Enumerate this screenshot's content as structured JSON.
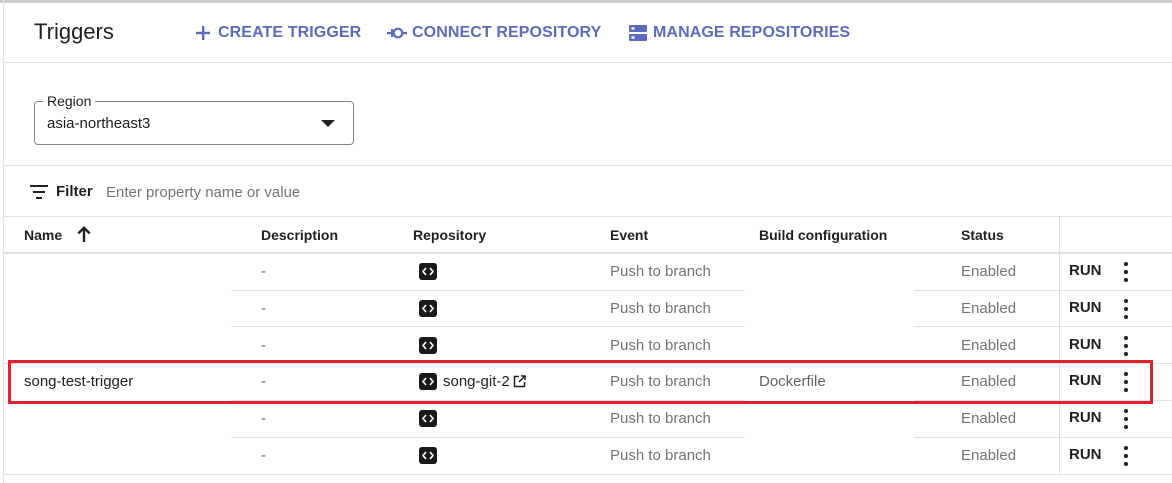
{
  "header": {
    "title": "Triggers",
    "create_trigger": "CREATE TRIGGER",
    "connect_repository": "CONNECT REPOSITORY",
    "manage_repositories": "MANAGE REPOSITORIES",
    "accent_color": "#5c6bc0"
  },
  "region": {
    "label": "Region",
    "value": "asia-northeast3"
  },
  "filter": {
    "label": "Filter",
    "placeholder": "Enter property name or value"
  },
  "table": {
    "columns": {
      "name": "Name",
      "description": "Description",
      "repository": "Repository",
      "event": "Event",
      "build": "Build configuration",
      "status": "Status"
    },
    "rows": [
      {
        "name": "",
        "description": "-",
        "repository": "",
        "event": "Push to branch",
        "build": "",
        "status": "Enabled",
        "action": "RUN"
      },
      {
        "name": "",
        "description": "-",
        "repository": "",
        "event": "Push to branch",
        "build": "",
        "status": "Enabled",
        "action": "RUN"
      },
      {
        "name": "",
        "description": "-",
        "repository": "",
        "event": "Push to branch",
        "build": "",
        "status": "Enabled",
        "action": "RUN"
      },
      {
        "name": "song-test-trigger",
        "description": "-",
        "repository": "song-git-2",
        "event": "Push to branch",
        "build": "Dockerfile",
        "status": "Enabled",
        "action": "RUN"
      },
      {
        "name": "",
        "description": "-",
        "repository": "",
        "event": "Push to branch",
        "build": "",
        "status": "Enabled",
        "action": "RUN"
      },
      {
        "name": "",
        "description": "-",
        "repository": "",
        "event": "Push to branch",
        "build": "",
        "status": "Enabled",
        "action": "RUN"
      }
    ]
  },
  "highlight_color": "#e0202a"
}
